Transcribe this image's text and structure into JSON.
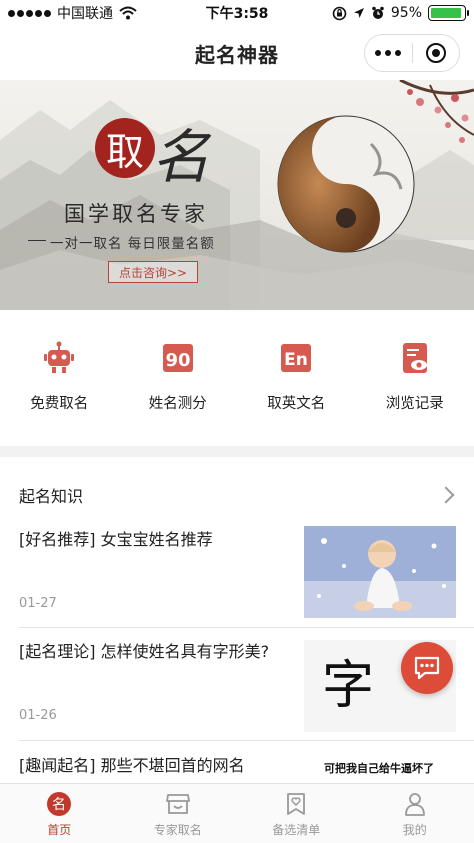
{
  "status_bar": {
    "carrier": "中国联通",
    "time": "下午3:58",
    "battery": "95%",
    "battery_level": 0.95
  },
  "nav": {
    "title": "起名神器"
  },
  "banner": {
    "seal_char": "取",
    "big_char": "名",
    "title": "国学取名专家",
    "subtitle": "一对一取名 每日限量名额",
    "button": "点击咨询>>"
  },
  "actions": [
    {
      "label": "免费取名",
      "icon": "robot-icon"
    },
    {
      "label": "姓名测分",
      "icon": "score-90-icon"
    },
    {
      "label": "取英文名",
      "icon": "en-icon"
    },
    {
      "label": "浏览记录",
      "icon": "history-eye-icon"
    }
  ],
  "knowledge": {
    "heading": "起名知识",
    "articles": [
      {
        "title": "[好名推荐] 女宝宝姓名推荐",
        "date": "01-27",
        "thumb": "baby-photo"
      },
      {
        "title": "[起名理论] 怎样使姓名具有字形美?",
        "date": "01-26",
        "thumb": "calligraphy-image",
        "thumb_text": "字 形"
      },
      {
        "title": "[趣闻起名] 那些不堪回首的网名",
        "thumb": "meme-image",
        "thumb_text": "可把我自己给牛逼坏了"
      }
    ]
  },
  "tabbar": [
    {
      "label": "首页",
      "icon": "home-seal-icon",
      "active": true
    },
    {
      "label": "专家取名",
      "icon": "shop-icon",
      "active": false
    },
    {
      "label": "备选清单",
      "icon": "bookmark-heart-icon",
      "active": false
    },
    {
      "label": "我的",
      "icon": "person-icon",
      "active": false
    }
  ],
  "colors": {
    "accent": "#c0392b",
    "seal_red": "#a3231f",
    "fab_red": "#dd4b39",
    "battery_green": "#36c148"
  }
}
